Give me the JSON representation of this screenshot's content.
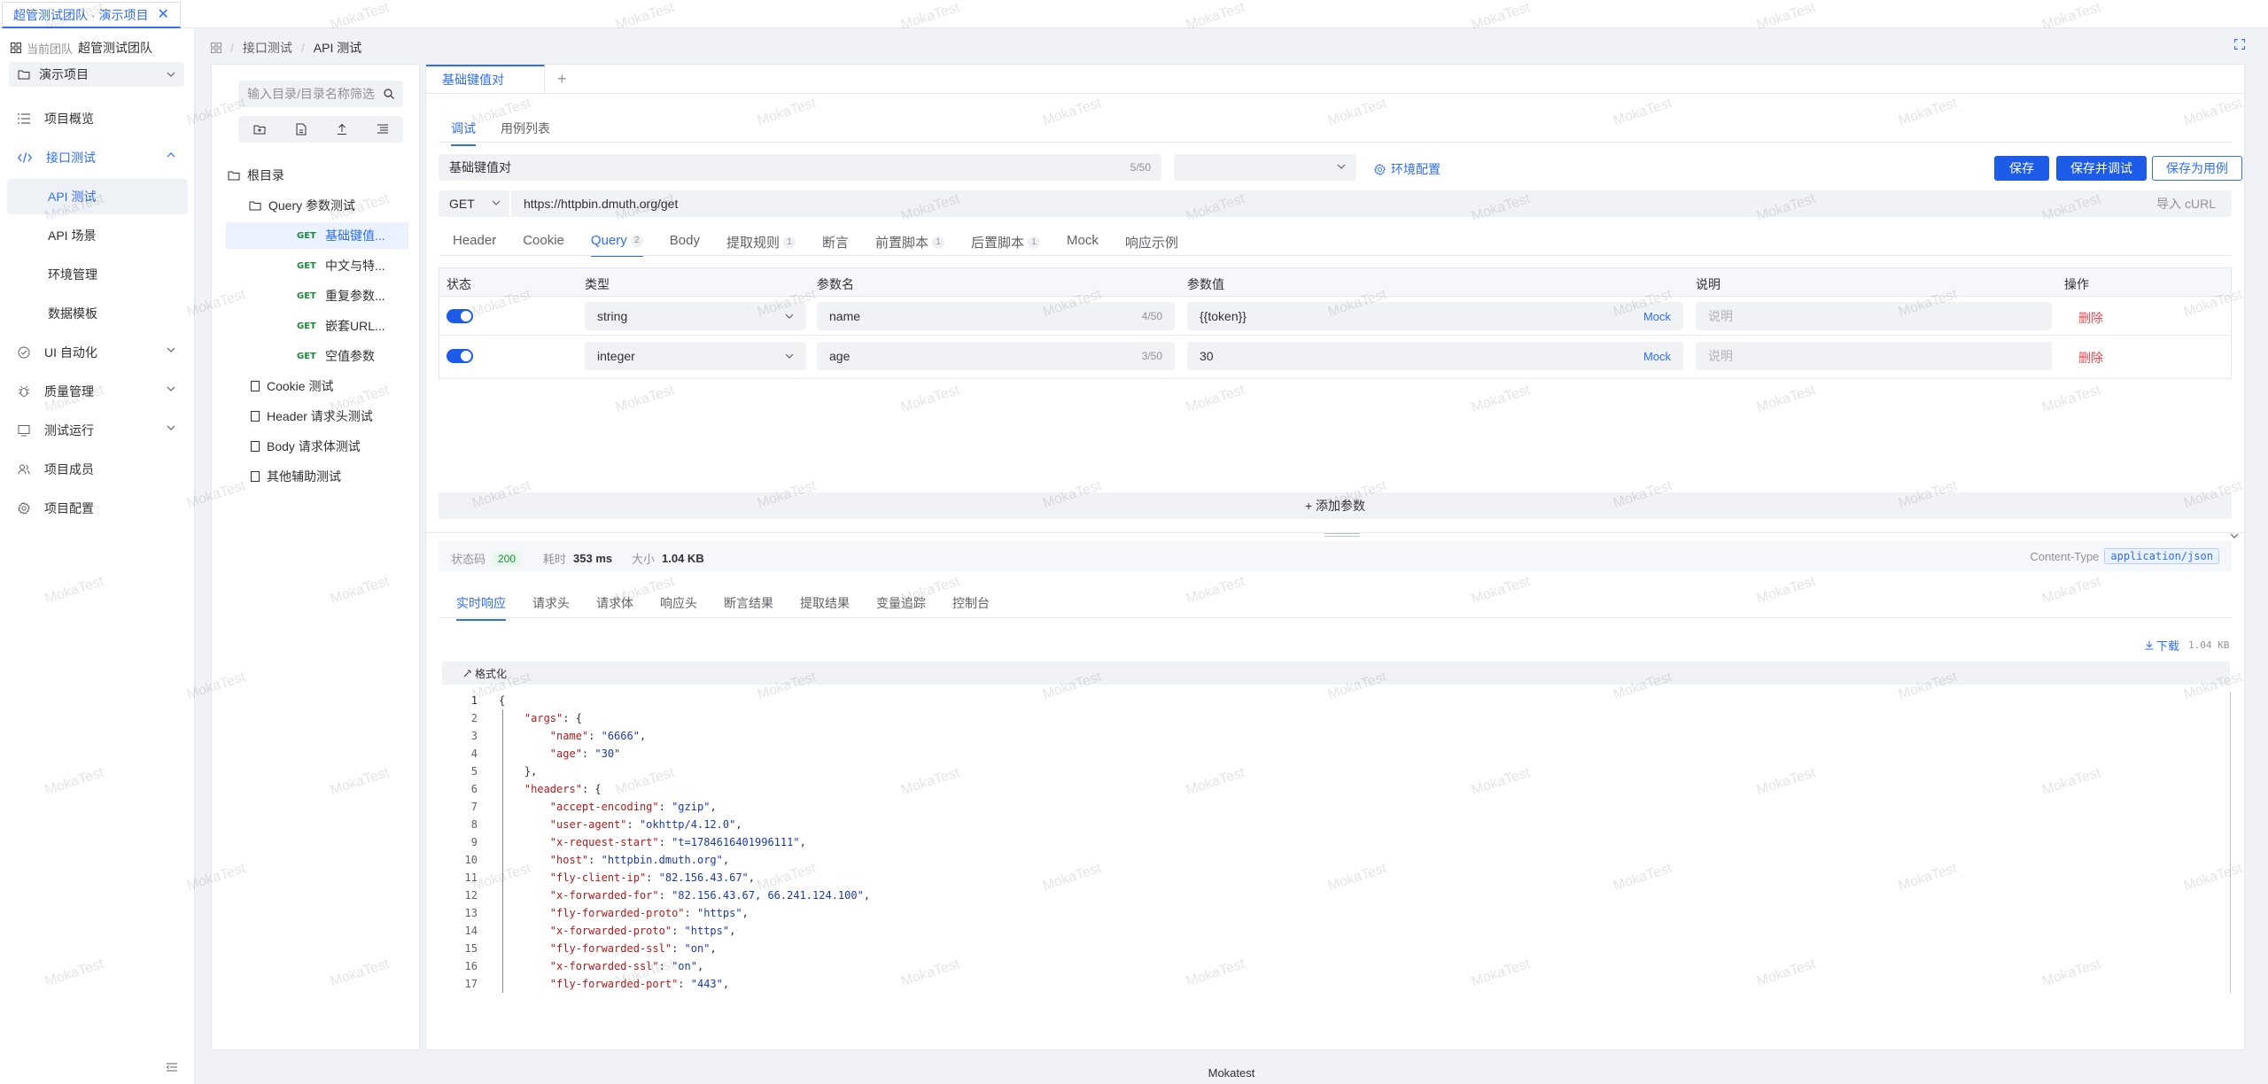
{
  "top_tab": {
    "label": "超管测试团队 · 演示项目",
    "close": "✕"
  },
  "team": {
    "label": "当前团队",
    "name": "超管测试团队"
  },
  "project": {
    "name": "演示项目"
  },
  "sidebar": {
    "items": [
      {
        "label": "项目概览",
        "icon": "list-icon"
      },
      {
        "label": "接口测试",
        "icon": "code-icon",
        "expanded": true
      },
      {
        "label": "API 测试",
        "active": true
      },
      {
        "label": "API 场景"
      },
      {
        "label": "环境管理"
      },
      {
        "label": "数据模板"
      },
      {
        "label": "UI 自动化",
        "icon": "check-circle-icon"
      },
      {
        "label": "质量管理",
        "icon": "bug-icon"
      },
      {
        "label": "测试运行",
        "icon": "monitor-icon"
      },
      {
        "label": "项目成员",
        "icon": "users-icon"
      },
      {
        "label": "项目配置",
        "icon": "gear-icon"
      }
    ]
  },
  "breadcrumb": {
    "items": [
      "接口测试",
      "API 测试"
    ],
    "separator": "/"
  },
  "tree": {
    "search_placeholder": "输入目录/目录名称筛选",
    "root": "根目录",
    "folder": "Query 参数测试",
    "method": "GET",
    "apis": [
      "基础键值...",
      "中文与特...",
      "重复参数...",
      "嵌套URL...",
      "空值参数"
    ],
    "docs": [
      "Cookie 测试",
      "Header 请求头测试",
      "Body 请求体测试",
      "其他辅助测试"
    ]
  },
  "editor": {
    "tab": "基础键值对",
    "add_tab": "+",
    "subtabs": [
      "调试",
      "用例列表"
    ],
    "name": "基础键值对",
    "name_count": "5/50",
    "env_config": "环境配置",
    "buttons": {
      "save": "保存",
      "save_debug": "保存并调试",
      "save_case": "保存为用例"
    },
    "method": "GET",
    "url": "https://httpbin.dmuth.org/get",
    "import_curl": "导入 cURL",
    "req_tabs": [
      {
        "label": "Header",
        "badge": ""
      },
      {
        "label": "Cookie",
        "badge": ""
      },
      {
        "label": "Query",
        "badge": "2",
        "active": true
      },
      {
        "label": "Body",
        "badge": ""
      },
      {
        "label": "提取规则",
        "badge": "1"
      },
      {
        "label": "断言",
        "badge": ""
      },
      {
        "label": "前置脚本",
        "badge": "1"
      },
      {
        "label": "后置脚本",
        "badge": "1"
      },
      {
        "label": "Mock",
        "badge": ""
      },
      {
        "label": "响应示例",
        "badge": ""
      }
    ],
    "params": {
      "headers": [
        "状态",
        "类型",
        "参数名",
        "参数值",
        "说明",
        "操作"
      ],
      "rows": [
        {
          "type": "string",
          "name": "name",
          "name_count": "4/50",
          "value": "{{token}}",
          "mock": "Mock",
          "desc_placeholder": "说明",
          "delete": "删除"
        },
        {
          "type": "integer",
          "name": "age",
          "name_count": "3/50",
          "value": "30",
          "mock": "Mock",
          "desc_placeholder": "说明",
          "delete": "删除"
        }
      ],
      "add": "+ 添加参数"
    }
  },
  "response": {
    "status_label": "状态码",
    "status": "200",
    "time_label": "耗时",
    "time": "353 ms",
    "size_label": "大小",
    "size": "1.04 KB",
    "content_type_label": "Content-Type",
    "content_type": "application/json",
    "tabs": [
      "实时响应",
      "请求头",
      "请求体",
      "响应头",
      "断言结果",
      "提取结果",
      "变量追踪",
      "控制台"
    ],
    "download": "下载",
    "download_size": "1.04 KB",
    "format": "格式化",
    "code_lines": [
      "{",
      "    \"args\": {",
      "        \"name\": \"6666\",",
      "        \"age\": \"30\"",
      "    },",
      "    \"headers\": {",
      "        \"accept-encoding\": \"gzip\",",
      "        \"user-agent\": \"okhttp/4.12.0\",",
      "        \"x-request-start\": \"t=1784616401996111\",",
      "        \"host\": \"httpbin.dmuth.org\",",
      "        \"fly-client-ip\": \"82.156.43.67\",",
      "        \"x-forwarded-for\": \"82.156.43.67, 66.241.124.100\",",
      "        \"fly-forwarded-proto\": \"https\",",
      "        \"x-forwarded-proto\": \"https\",",
      "        \"fly-forwarded-ssl\": \"on\",",
      "        \"x-forwarded-ssl\": \"on\",",
      "        \"fly-forwarded-port\": \"443\","
    ]
  },
  "footer": "Mokatest",
  "watermark": "MokaTest",
  "colors": {
    "accent": "#2f6ef5",
    "primary_button": "#1c5ce8",
    "danger": "#e5484d",
    "success": "#1b8a3a"
  }
}
